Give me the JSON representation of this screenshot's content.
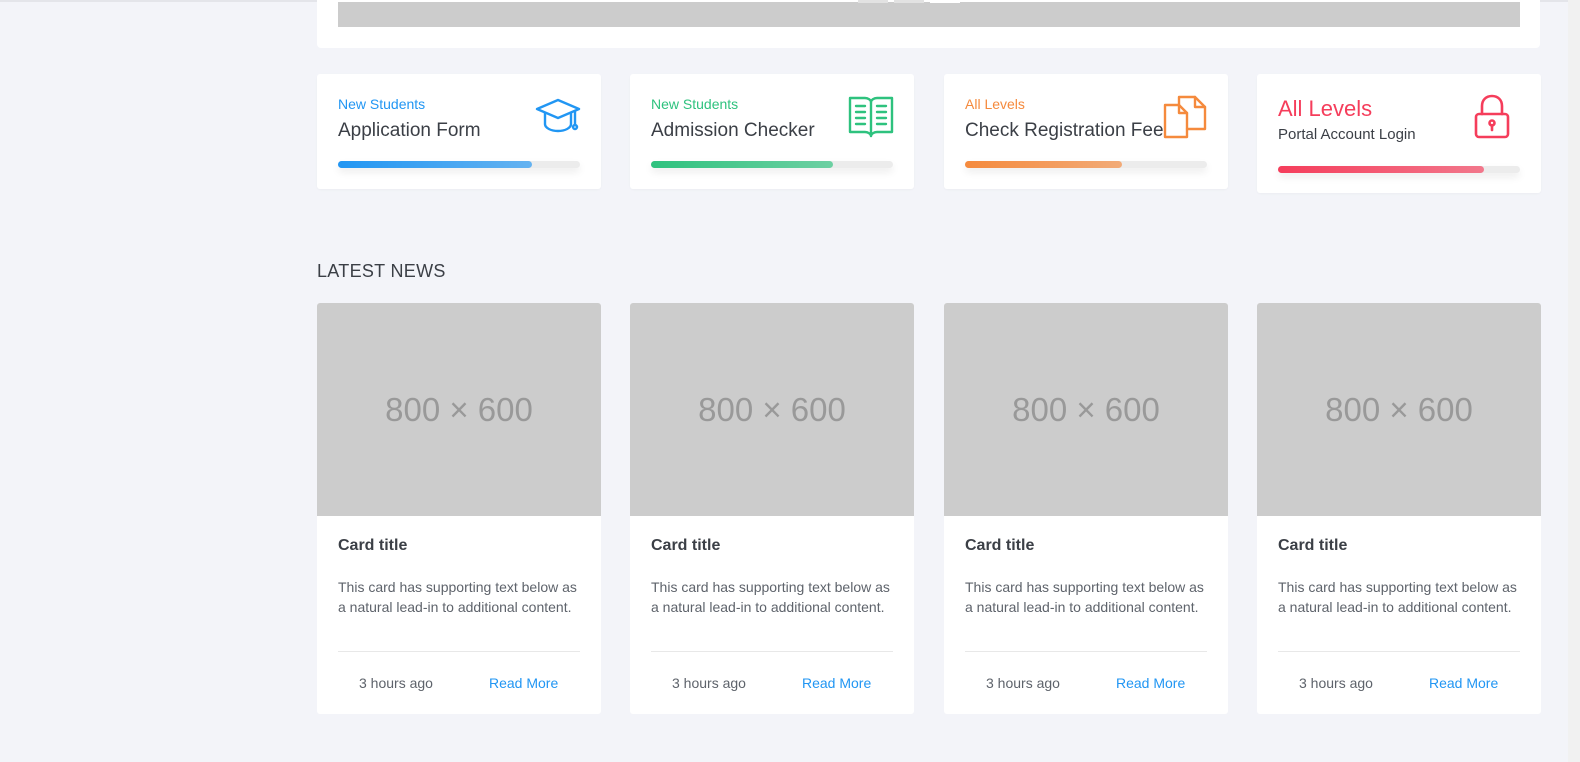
{
  "colors": {
    "blue": "#2196f3",
    "green": "#2ec27e",
    "orange": "#f58a3d",
    "red": "#f53d5b",
    "background": "#f3f4f9",
    "placeholder": "#cccccc"
  },
  "quick_links": [
    {
      "subtitle": "New Students",
      "title": "Application Form",
      "icon": "graduation-cap-icon",
      "color": "#2196f3",
      "progress_pct": 80
    },
    {
      "subtitle": "New Students",
      "title": "Admission Checker",
      "icon": "open-book-icon",
      "color": "#2ec27e",
      "progress_pct": 75
    },
    {
      "subtitle": "All Levels",
      "title": "Check Registration Fee",
      "icon": "documents-icon",
      "color": "#f58a3d",
      "progress_pct": 65
    },
    {
      "subtitle": "Portal Account Login",
      "title": "All Levels",
      "icon": "lock-icon",
      "color": "#f53d5b",
      "progress_pct": 85
    }
  ],
  "news": {
    "heading": "LATEST NEWS",
    "cards": [
      {
        "image_label": "800 × 600",
        "title": "Card title",
        "text": "This card has supporting text below as a natural lead-in to additional content.",
        "time": "3 hours ago",
        "link": "Read More"
      },
      {
        "image_label": "800 × 600",
        "title": "Card title",
        "text": "This card has supporting text below as a natural lead-in to additional content.",
        "time": "3 hours ago",
        "link": "Read More"
      },
      {
        "image_label": "800 × 600",
        "title": "Card title",
        "text": "This card has supporting text below as a natural lead-in to additional content.",
        "time": "3 hours ago",
        "link": "Read More"
      },
      {
        "image_label": "800 × 600",
        "title": "Card title",
        "text": "This card has supporting text below as a natural lead-in to additional content.",
        "time": "3 hours ago",
        "link": "Read More"
      }
    ]
  }
}
